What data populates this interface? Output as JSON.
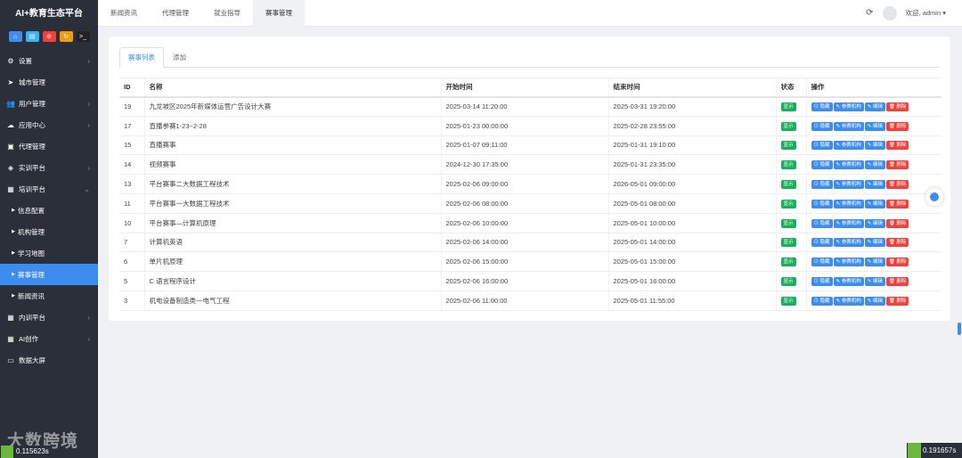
{
  "app": {
    "title": "AI+教育生态平台"
  },
  "quick_icons": [
    {
      "icon": "home-icon",
      "color": "#3c8dee",
      "glyph": "⌂"
    },
    {
      "icon": "document-icon",
      "color": "#3cb2ee",
      "glyph": "▤"
    },
    {
      "icon": "stop-icon",
      "color": "#f0413c",
      "glyph": "⊘"
    },
    {
      "icon": "refresh-icon",
      "color": "#f39c12",
      "glyph": "↻"
    },
    {
      "icon": "terminal-icon",
      "color": "#222222",
      "glyph": ">_"
    }
  ],
  "sidebar": {
    "items": [
      {
        "label": "设置",
        "icon": "gear-icon",
        "glyph": "⚙",
        "chevron": true
      },
      {
        "label": "城市管理",
        "icon": "send-icon",
        "glyph": "➤",
        "chevron": false
      },
      {
        "label": "用户管理",
        "icon": "users-icon",
        "glyph": "👥",
        "chevron": true
      },
      {
        "label": "应用中心",
        "icon": "cloud-icon",
        "glyph": "☁",
        "chevron": true
      },
      {
        "label": "代理管理",
        "icon": "id-card-icon",
        "glyph": "▣",
        "chevron": false
      },
      {
        "label": "实训平台",
        "icon": "cube-icon",
        "glyph": "◈",
        "chevron": true
      },
      {
        "label": "培训平台",
        "icon": "grid-icon",
        "glyph": "▦",
        "chevron": true,
        "expanded": true
      },
      {
        "label": "信息配置",
        "icon": "caret-right-icon",
        "glyph": "▶",
        "sub": true
      },
      {
        "label": "机构管理",
        "icon": "caret-right-icon",
        "glyph": "▶",
        "sub": true
      },
      {
        "label": "学习地图",
        "icon": "caret-right-icon",
        "glyph": "▶",
        "sub": true
      },
      {
        "label": "赛事管理",
        "icon": "caret-right-icon",
        "glyph": "▶",
        "sub": true,
        "active": true
      },
      {
        "label": "新闻资讯",
        "icon": "caret-right-icon",
        "glyph": "▶",
        "sub": true
      },
      {
        "label": "内训平台",
        "icon": "grid-icon",
        "glyph": "▦",
        "chevron": true
      },
      {
        "label": "AI创作",
        "icon": "grid-icon",
        "glyph": "▦",
        "chevron": true
      },
      {
        "label": "数据大屏",
        "icon": "monitor-icon",
        "glyph": "▭",
        "chevron": false
      }
    ]
  },
  "topbar": {
    "tabs": [
      {
        "label": "新闻资讯",
        "active": false
      },
      {
        "label": "代理管理",
        "active": false
      },
      {
        "label": "就业指导",
        "active": false
      },
      {
        "label": "赛事管理",
        "active": true
      }
    ],
    "welcome": "欢迎, admin ▾"
  },
  "subtabs": [
    {
      "label": "赛事列表",
      "active": true
    },
    {
      "label": "添加",
      "active": false
    }
  ],
  "table": {
    "columns": [
      "ID",
      "名称",
      "开始时间",
      "结束时间",
      "状态",
      "操作"
    ],
    "action_labels": {
      "status": "显示",
      "hide": "隐藏",
      "org": "参赛机构",
      "edit": "编辑",
      "delete": "删除"
    },
    "rows": [
      {
        "id": "19",
        "name": "九龙坡区2025年新媒体运营广告设计大赛",
        "start": "2025-03-14 11:20:00",
        "end": "2025-03-31 19:20:00"
      },
      {
        "id": "17",
        "name": "直播参赛1-23~2-28",
        "start": "2025-01-23 00:00:00",
        "end": "2025-02-28 23:55:00"
      },
      {
        "id": "15",
        "name": "直播赛事",
        "start": "2025-01-07 09:11:00",
        "end": "2025-01-31 19:10:00"
      },
      {
        "id": "14",
        "name": "视频赛事",
        "start": "2024-12-30 17:35:00",
        "end": "2025-01-31 23:35:00"
      },
      {
        "id": "13",
        "name": "平台赛事二大数据工程技术",
        "start": "2025-02-06 09:00:00",
        "end": "2026-05-01 09:00:00"
      },
      {
        "id": "11",
        "name": "平台赛事一大数据工程技术",
        "start": "2025-02-06 08:00:00",
        "end": "2025-05-01 08:00:00"
      },
      {
        "id": "10",
        "name": "平台赛事—计算机原理",
        "start": "2025-02-06 10:00:00",
        "end": "2025-05-01 10:00:00"
      },
      {
        "id": "7",
        "name": "计算机英语",
        "start": "2025-02-06 14:00:00",
        "end": "2025-05-01 14:00:00"
      },
      {
        "id": "6",
        "name": "单片机原理",
        "start": "2025-02-06 15:00:00",
        "end": "2025-05-01 15:00:00"
      },
      {
        "id": "5",
        "name": "C 语言程序设计",
        "start": "2025-02-06 16:00:00",
        "end": "2025-05-01 16:00:00"
      },
      {
        "id": "3",
        "name": "机电设备制造类一电气工程",
        "start": "2025-02-06 11:00:00",
        "end": "2025-05-01 11:55:00"
      }
    ]
  },
  "watermark": "大数跨境",
  "timers": {
    "left": "0.115623s",
    "right": "0.191657s"
  }
}
